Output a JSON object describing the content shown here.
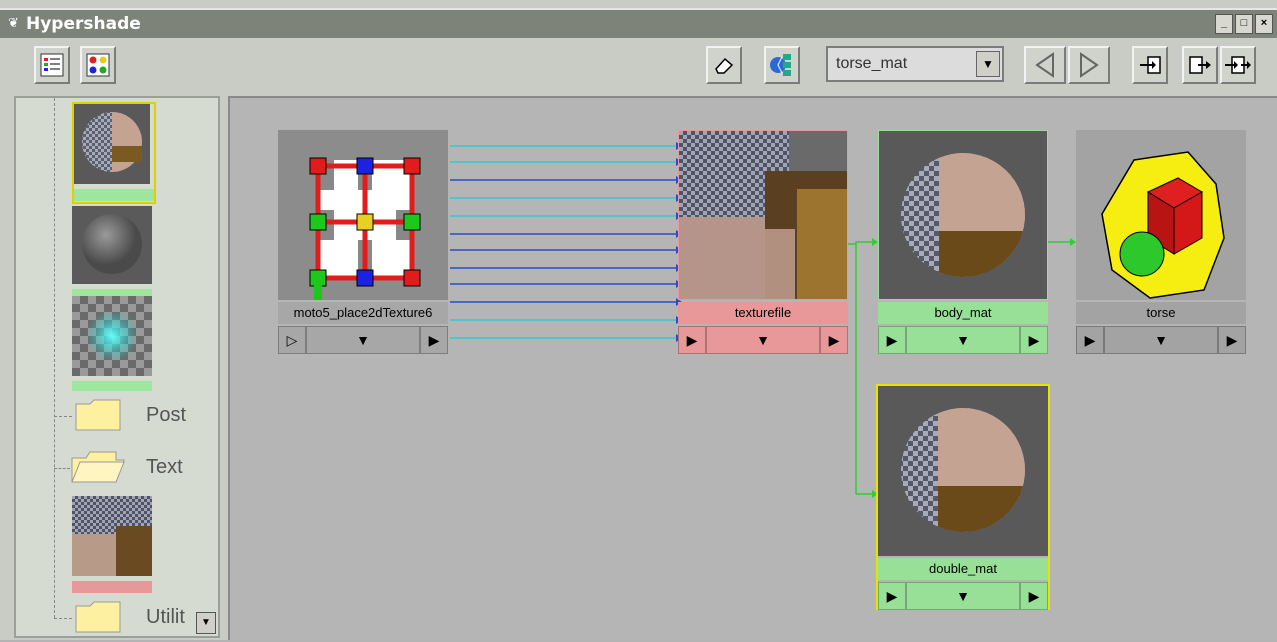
{
  "window": {
    "title": "Hypershade",
    "controls": [
      "_",
      "□",
      "×"
    ]
  },
  "toolbar": {
    "left_buttons": [
      "list-view-icon",
      "swatch-view-icon"
    ],
    "right_buttons": [
      "eraser-icon",
      "graph-network-icon"
    ],
    "material_select": "torse_mat",
    "nav_buttons": [
      "arrow-left-icon",
      "arrow-right-icon"
    ],
    "graph_buttons": [
      "input-connections-icon",
      "output-connections-icon",
      "input-output-connections-icon"
    ]
  },
  "tree": {
    "items": [
      {
        "type": "folder",
        "label": "Post"
      },
      {
        "type": "folder",
        "label": "Text"
      },
      {
        "type": "folder",
        "label": "Utilit"
      }
    ]
  },
  "nodes": [
    {
      "id": "place2d",
      "label": "moto5_place2dTexture6",
      "color": "#a7a7a7"
    },
    {
      "id": "texturefile",
      "label": "texturefile",
      "color": "#e89898"
    },
    {
      "id": "body_mat",
      "label": "body_mat",
      "color": "#98e098"
    },
    {
      "id": "torse",
      "label": "torse",
      "color": "#a3a3a3"
    },
    {
      "id": "double_mat",
      "label": "double_mat",
      "color": "#98e098"
    }
  ],
  "colors": {
    "accent_green": "#2fcf2f",
    "accent_blue": "#2a4cc7",
    "accent_cyan": "#33c8d8",
    "selection_yellow": "#e5e500"
  }
}
